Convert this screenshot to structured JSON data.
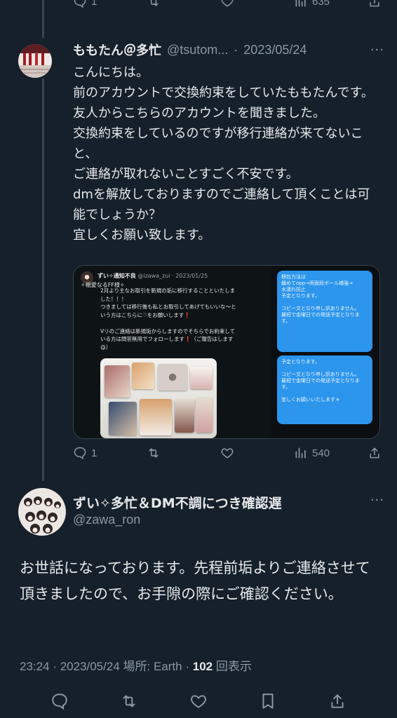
{
  "top_actions": {
    "reply_count": "1",
    "retweet_count": "",
    "like_count": "",
    "views": "635"
  },
  "tweet1": {
    "display_name": "ももたん＠多忙",
    "handle": "@tsutom...",
    "dot": "·",
    "date": "2023/05/24",
    "more": "···",
    "text": "こんにちは。\n前のアカウントで交換約束をしていたももたんです。\n友人からこちらのアカウントを聞きました。\n交換約束をしているのですが移行連絡が来てないこと、\nご連絡が取れないことすごく不安です。\ndmを解放しておりますのでご連絡して頂くことは可能でしょうか？\n宜しくお願い致します。",
    "media": {
      "mini_name": "ずい✧通知不良",
      "mini_handle_date": "@izawa_zui · 2023/01/25",
      "mini_sub": "✧親愛なるFF様✧",
      "mini_text": "2月より主なお取引を新規の垢に移行することといたしました！！！\nつきましては移行後も私とお取引してあげてもいいな～という方はこちらに♡をお願いします❗\n\nVリのご連絡は新規垢からしますのでそちらでお約束している方は問答無用でフォローします❗（ご報告はします😋）",
      "bubble1": "梱包方法は\n纏めてopp→両面段ボール補強→\n水濡れ防止\n予定となります。\n\nコピー文となり申し訳ありません。\n最短で金曜日での発送予定となります。",
      "bubble2": "予定となります。\n\nコピー文となり申し訳ありません。\n最短で金曜日での発送予定となります。\n\n宜しくお願いいたします＊"
    },
    "actions": {
      "reply_count": "1",
      "retweet_count": "",
      "like_count": "",
      "views": "540"
    }
  },
  "tweet2": {
    "display_name": "ずい✧多忙＆DM不調につき確認遅",
    "handle": "@zawa_ron",
    "more": "···",
    "text": "お世話になっております。先程前垢よりご連絡させて頂きましたので、お手隙の際にご確認ください。",
    "time": "23:24",
    "date": "2023/05/24",
    "location_label": "場所: Earth",
    "views_count": "102",
    "views_label": "回表示",
    "sep": "·"
  },
  "colors": {
    "background": "#15202b",
    "text": "#e7e9ea",
    "secondary": "#8b98a5",
    "thread_line": "#38444d",
    "accent_blue": "#2c95ec"
  },
  "icons": [
    "reply-icon",
    "retweet-icon",
    "like-icon",
    "views-icon",
    "share-icon",
    "bookmark-icon",
    "more-icon"
  ]
}
